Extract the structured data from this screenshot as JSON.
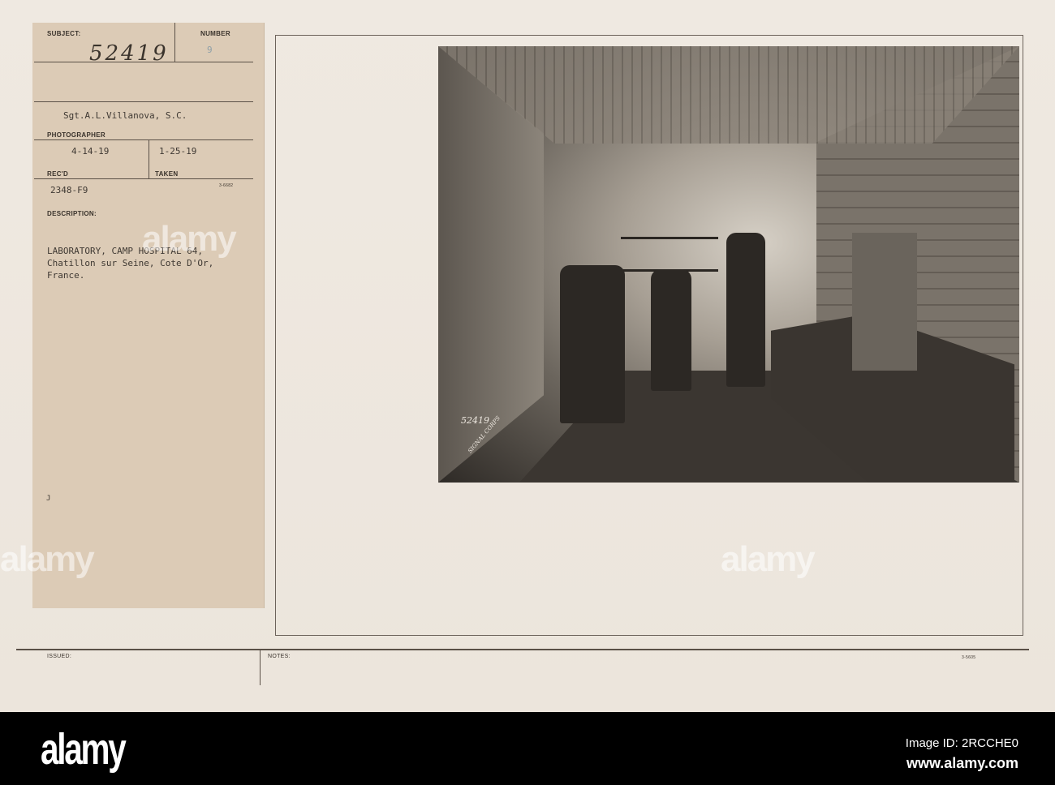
{
  "card": {
    "subject_label": "SUBJECT:",
    "subject_number": "52419",
    "number_label": "NUMBER",
    "number_value": "9",
    "photographer": "Sgt.A.L.Villanova, S.C.",
    "photographer_label": "PHOTOGRAPHER",
    "recd_date": "4-14-19",
    "recd_label": "REC'D",
    "taken_date": "1-25-19",
    "taken_label": "TAKEN",
    "file_code": "2348-F9",
    "form_code": "3-6682",
    "description_label": "DESCRIPTION:",
    "description_lines": [
      "LABORATORY, CAMP HOSPITAL 64,",
      "Chatillon sur Seine, Cote D'Or,",
      "France."
    ],
    "mark": "J",
    "issued_label": "ISSUED:",
    "notes_label": "NOTES:",
    "form_code_bottom": "3-5605"
  },
  "photo": {
    "stamp_number": "52419",
    "stamp_text": "SIGNAL CORPS"
  },
  "watermark": "alamy",
  "footer": {
    "logo": "alamy",
    "image_id": "Image ID: 2RCCHE0",
    "site": "www.alamy.com"
  }
}
